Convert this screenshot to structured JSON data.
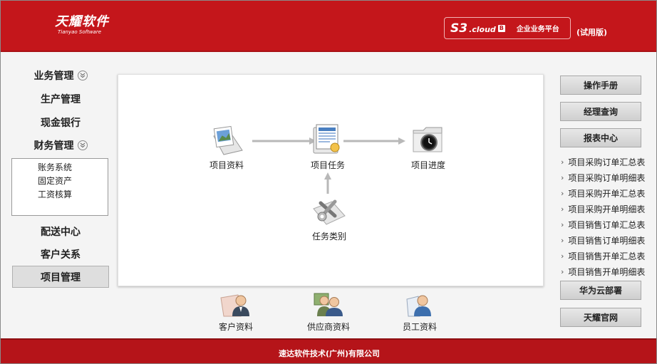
{
  "header": {
    "logo_cn": "天耀软件",
    "logo_en": "Tianyao Software",
    "brand_s3": "S3",
    "brand_cloud": ".cloud",
    "brand_badge": "B",
    "brand_platform": "企业业务平台",
    "trial": "(试用版)"
  },
  "nav": {
    "items": [
      {
        "label": "业务管理"
      },
      {
        "label": "生产管理"
      },
      {
        "label": "现金银行"
      },
      {
        "label": "财务管理"
      },
      {
        "label": "配送中心"
      },
      {
        "label": "客户关系"
      },
      {
        "label": "项目管理"
      }
    ],
    "finance_sub": [
      "账务系统",
      "固定资产",
      "工资核算"
    ]
  },
  "flow": {
    "project_info": "项目资料",
    "project_task": "项目任务",
    "project_progress": "项目进度",
    "task_category": "任务类别"
  },
  "bottom": {
    "customer_info": "客户资料",
    "supplier_info": "供应商资料",
    "employee_info": "员工资料"
  },
  "right": {
    "manual": "操作手册",
    "manager_query": "经理查询",
    "report_center": "报表中心",
    "reports": [
      "项目采购订单汇总表",
      "项目采购订单明细表",
      "项目采购开单汇总表",
      "项目采购开单明细表",
      "项目销售订单汇总表",
      "项目销售订单明细表",
      "项目销售开单汇总表",
      "项目销售开单明细表"
    ],
    "huawei": "华为云部署",
    "official": "天耀官网"
  },
  "footer": {
    "company": "速达软件技术(广州)有限公司"
  },
  "colors": {
    "brand_red": "#c4161b",
    "footer_red": "#b51419"
  }
}
